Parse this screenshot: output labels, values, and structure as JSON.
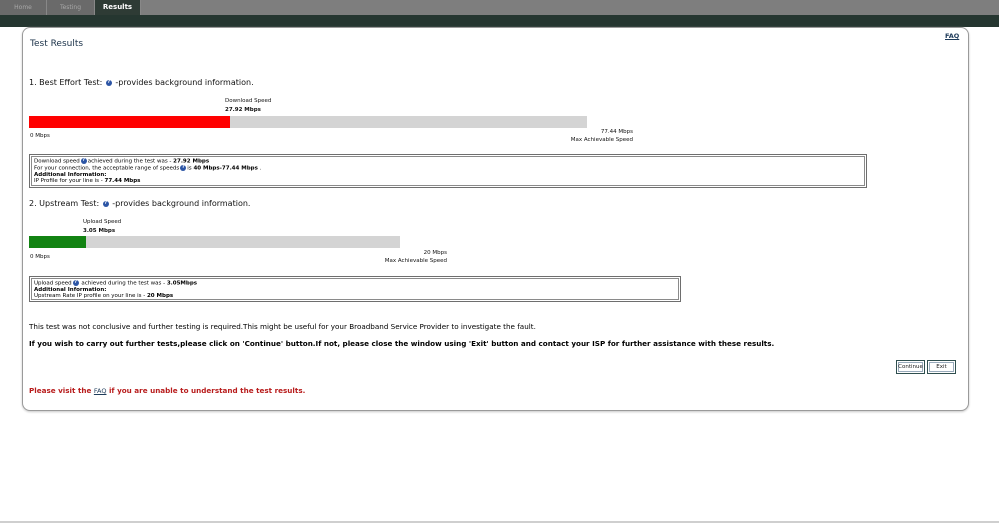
{
  "nav": {
    "tabs": [
      {
        "label": "Home"
      },
      {
        "label": "Testing"
      },
      {
        "label": "Results"
      }
    ]
  },
  "page": {
    "title": "Test Results",
    "faq_link": "FAQ"
  },
  "best_effort": {
    "heading_prefix": "1. Best Effort Test:",
    "heading_suffix": "-provides background information.",
    "speed_label": "Download Speed",
    "speed_value": "27.92 Mbps",
    "min_label": "0 Mbps",
    "max_value": "77.44 Mbps",
    "max_label": "Max Achievable Speed",
    "progress_fraction": 0.3606,
    "fill_color": "#ff0000",
    "info": {
      "l1_a": "Download speed",
      "l1_b": "achieved during the test was - ",
      "l1_val": "27.92 Mbps",
      "l2_a": "For your connection, the acceptable range of speeds",
      "l2_b": "is ",
      "l2_val": "40 Mbps-77.44 Mbps",
      "l2_end": " .",
      "l3": "Additional Information:",
      "l4_a": "IP Profile for your line is - ",
      "l4_val": "77.44 Mbps"
    }
  },
  "upstream": {
    "heading_prefix": "2. Upstream Test:",
    "heading_suffix": "-provides background information.",
    "speed_label": "Upload Speed",
    "speed_value": "3.05 Mbps",
    "min_label": "0 Mbps",
    "max_value": "20 Mbps",
    "max_label": "Max Achievable Speed",
    "progress_fraction": 0.1525,
    "fill_color": "#128312",
    "info": {
      "l1_a": "Upload speed",
      "l1_b": " achieved during the test was - ",
      "l1_val": "3.05Mbps",
      "l2": "Additional Information:",
      "l3_a": "Upstream Rate IP profile on your line is - ",
      "l3_val": "20 Mbps"
    }
  },
  "messages": {
    "inconclusive": "This test was not conclusive and further testing is required.This might be useful for your Broadband Service Provider to investigate the fault.",
    "instructions": "If you wish to carry out further tests,please click on 'Continue' button.If not, please close the window using 'Exit' button and contact your ISP for further assistance with these results.",
    "visit_prefix": "Please visit the ",
    "visit_link": "FAQ",
    "visit_suffix": " if you are unable to understand the test results."
  },
  "buttons": {
    "continue": "Continue",
    "exit": "Exit"
  },
  "icons": {
    "help": "help-icon"
  },
  "colors": {
    "header_dark": "#253630",
    "red_notice": "#b81c1c"
  }
}
